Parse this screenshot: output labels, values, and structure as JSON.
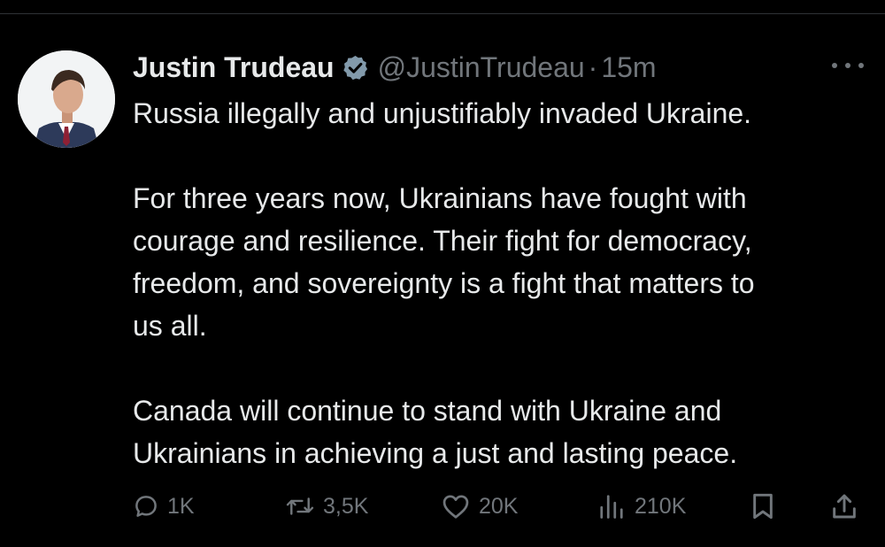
{
  "tweet": {
    "display_name": "Justin Trudeau",
    "handle": "@JustinTrudeau",
    "separator": "·",
    "time": "15m",
    "paragraphs": [
      [
        "Russia illegally and unjustifiably invaded Ukraine."
      ],
      [
        "For three years now, Ukrainians have fought with",
        "courage and resilience. Their fight for democracy,",
        "freedom, and sovereignty is a fight that matters to",
        "us all."
      ],
      [
        "Canada will continue to stand with Ukraine and",
        "Ukrainians in achieving a just and lasting peace."
      ]
    ]
  },
  "actions": {
    "replies": "1K",
    "reposts": "3,5K",
    "likes": "20K",
    "views": "210K"
  },
  "icons": {
    "verified": "verified-badge-icon",
    "more": "more-icon",
    "reply": "reply-icon",
    "repost": "repost-icon",
    "like": "heart-icon",
    "views": "views-icon",
    "bookmark": "bookmark-icon",
    "share": "share-icon"
  },
  "colors": {
    "background": "#000000",
    "text": "#e7e9ea",
    "secondary": "#71767b",
    "verified_badge": "#829aab"
  }
}
